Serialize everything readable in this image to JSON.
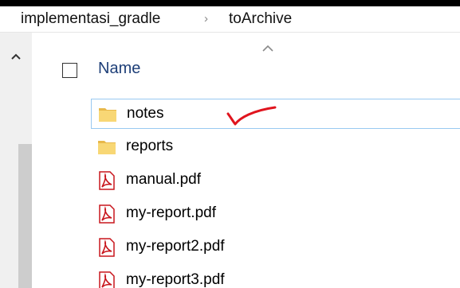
{
  "breadcrumb": {
    "path": [
      "implementasi_gradle",
      "toArchive"
    ],
    "separator": "›"
  },
  "file_list": {
    "column_header": "Name",
    "sort": "ascending",
    "items": [
      {
        "name": "notes",
        "type": "folder",
        "selected": true,
        "annotation": "red-checkmark"
      },
      {
        "name": "reports",
        "type": "folder"
      },
      {
        "name": "manual.pdf",
        "type": "pdf"
      },
      {
        "name": "my-report.pdf",
        "type": "pdf"
      },
      {
        "name": "my-report2.pdf",
        "type": "pdf"
      },
      {
        "name": "my-report3.pdf",
        "type": "pdf"
      }
    ]
  },
  "colors": {
    "selection_border": "#99c9f1",
    "header_text": "#1e3f78",
    "folder": "#f8d775",
    "pdf": "#c8161d",
    "annotation": "#e0141e"
  }
}
